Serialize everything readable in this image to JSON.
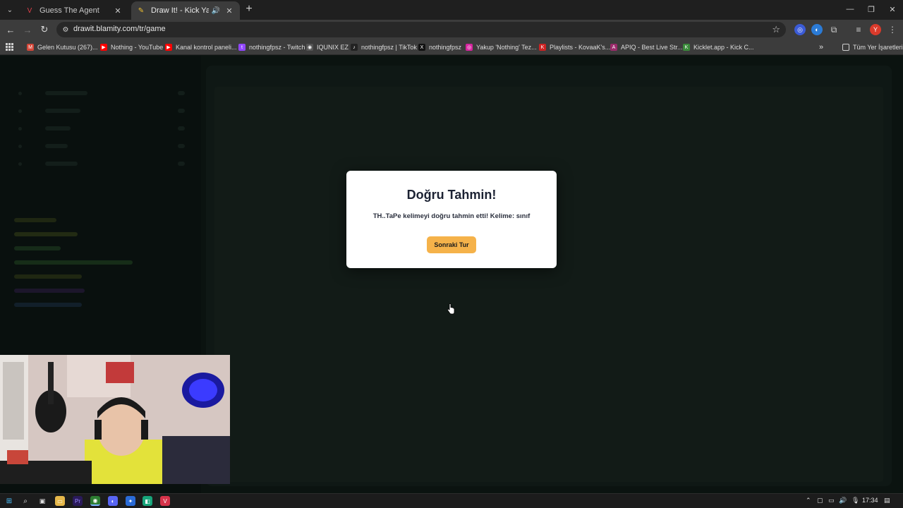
{
  "browser": {
    "tabs": [
      {
        "label": "Guess The Agent",
        "active": false,
        "favicon": "valorant-icon",
        "color": "#e0404a"
      },
      {
        "label": "Draw It! - Kick Yayınları İçin",
        "active": true,
        "favicon": "drawit-icon",
        "color": "#f0c030"
      }
    ],
    "url": "drawit.blamity.com/tr/game",
    "bookmarks": [
      {
        "label": "Gelen Kutusu (267)...",
        "icon": "gmail-icon",
        "color": "#d44638"
      },
      {
        "label": "Nothing - YouTube",
        "icon": "youtube-icon",
        "color": "#ff0000"
      },
      {
        "label": "Kanal kontrol paneli...",
        "icon": "youtube-studio-icon",
        "color": "#ff0000"
      },
      {
        "label": "nothingfpsz - Twitch",
        "icon": "twitch-icon",
        "color": "#9146ff"
      },
      {
        "label": "IQUNIX EZ",
        "icon": "iqunix-icon",
        "color": "#555555"
      },
      {
        "label": "nothingfpsz | TikTok",
        "icon": "tiktok-icon",
        "color": "#222222"
      },
      {
        "label": "nothingfpsz",
        "icon": "x-icon",
        "color": "#111111"
      },
      {
        "label": "Yakup 'Nothing' Tez...",
        "icon": "instagram-icon",
        "color": "#d6249f"
      },
      {
        "label": "Playlists - KovaaK's...",
        "icon": "kovaaks-icon",
        "color": "#cc2222"
      },
      {
        "label": "APIQ - Best Live Str...",
        "icon": "apiq-icon",
        "color": "#9a2a6a"
      },
      {
        "label": "Kicklet.app - Kick C...",
        "icon": "kicklet-icon",
        "color": "#3a8a3a"
      }
    ],
    "all_bookmarks_label": "Tüm Yer İşaretleri"
  },
  "modal": {
    "title": "Doğru Tahmin!",
    "message": "TH..TaPe kelimeyi doğru tahmin etti! Kelime: sınıf",
    "next_button": "Sonraki Tur"
  },
  "taskbar": {
    "time": "17:34"
  },
  "colors": {
    "accent_button": "#f5b24a",
    "page_bg": "#0f1a16"
  }
}
